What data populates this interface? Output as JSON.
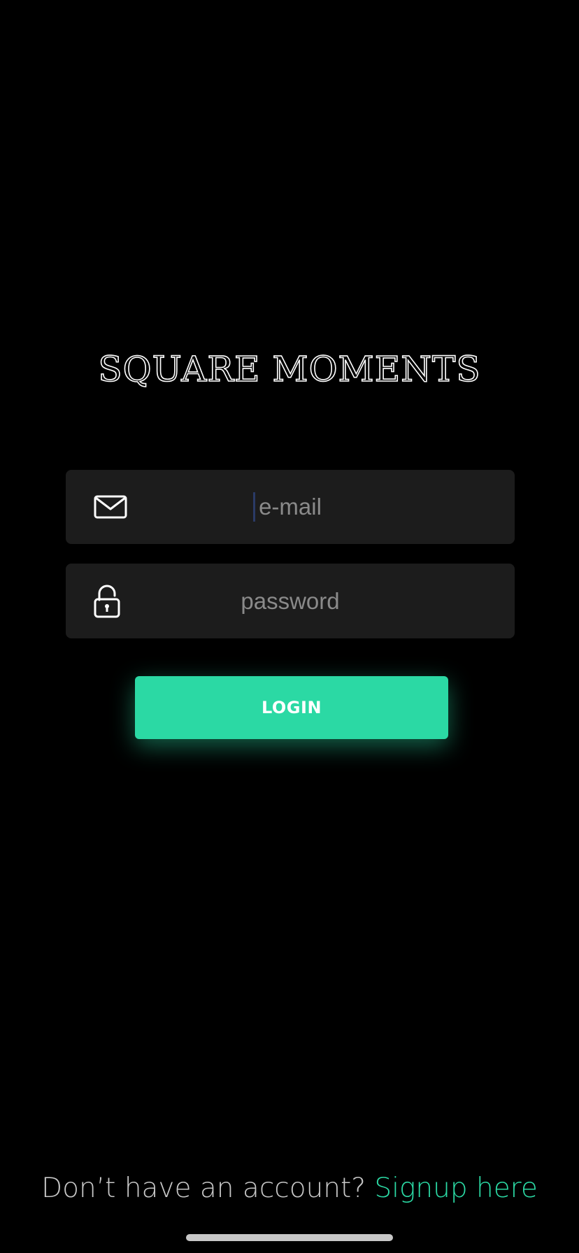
{
  "app": {
    "title": "SQUARE MOMENTS"
  },
  "login_form": {
    "email": {
      "icon": "envelope-icon",
      "placeholder": "e-mail",
      "value": ""
    },
    "password": {
      "icon": "lock-icon",
      "placeholder": "password",
      "value": ""
    },
    "login_label": "LOGIN"
  },
  "signup": {
    "prompt": "Don’t have an account? ",
    "link_label": "Signup here"
  },
  "colors": {
    "background": "#000000",
    "field_background": "#1c1c1c",
    "accent": "#2bd9a4",
    "placeholder": "#8a8a8a",
    "muted_text": "#c8c8c8"
  }
}
